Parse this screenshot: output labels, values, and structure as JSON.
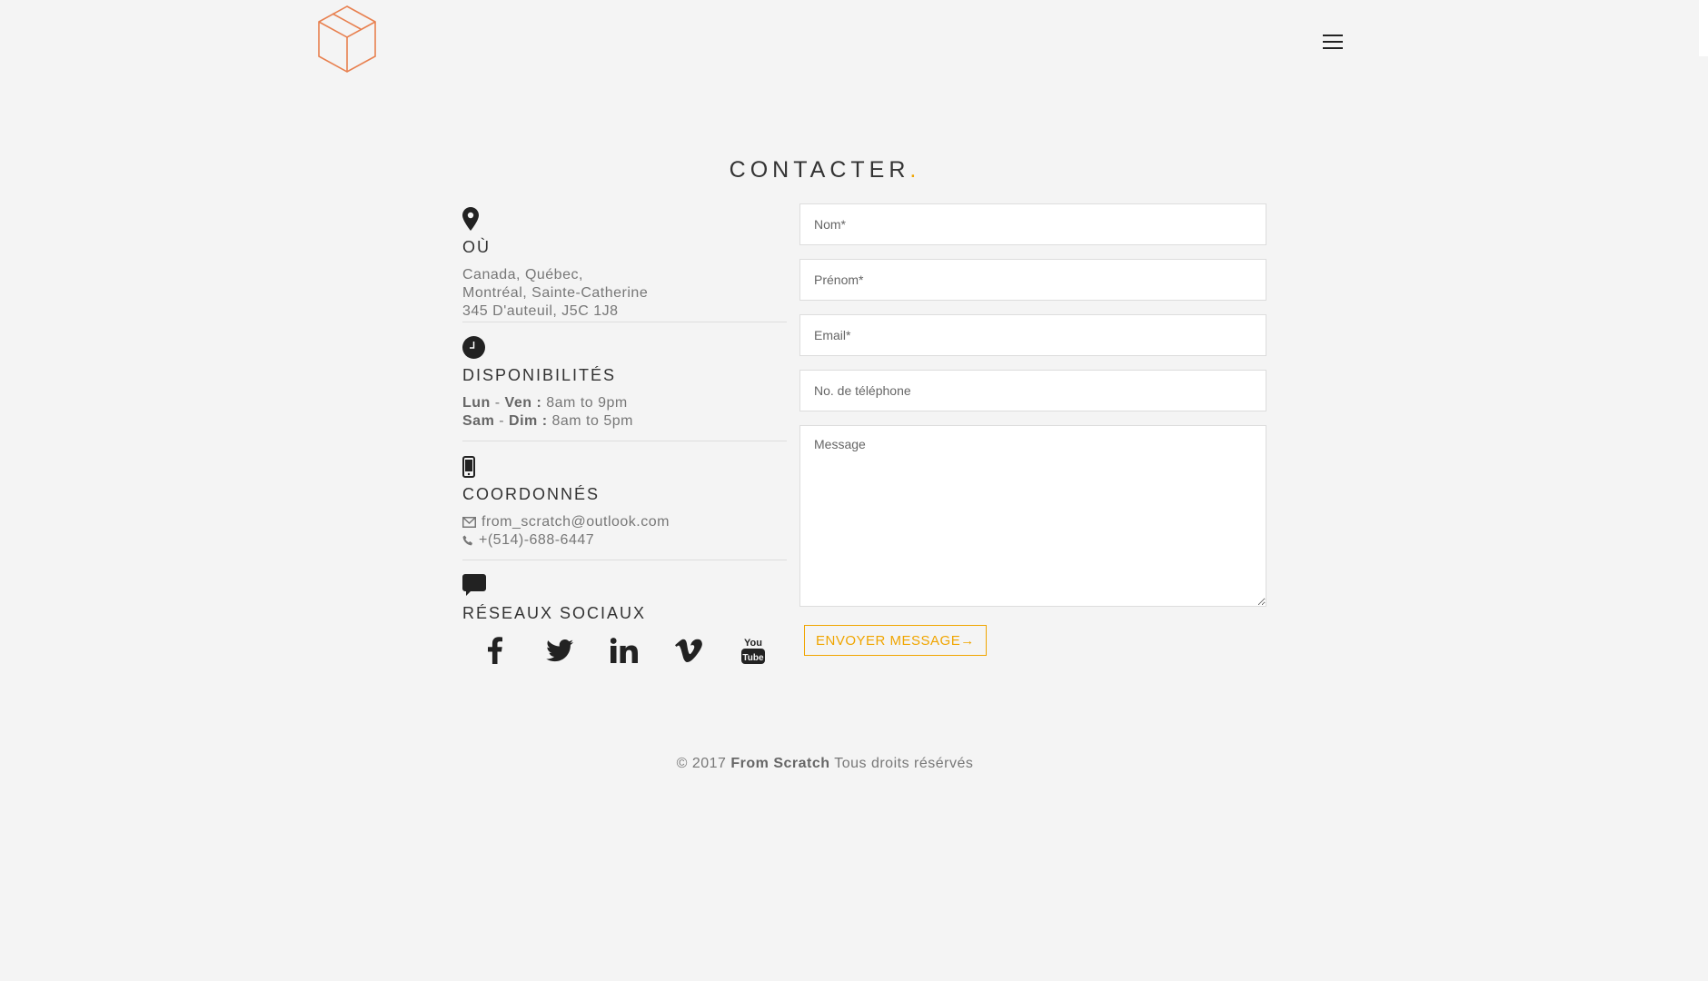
{
  "header": {
    "logo_name": "cube-logo",
    "menu_icon": "hamburger-menu-icon"
  },
  "title": {
    "text": "CONTACTER",
    "dot": "."
  },
  "info": {
    "where": {
      "icon": "map-pin-icon",
      "heading": "OÙ",
      "lines": [
        "Canada, Québec,",
        "Montréal, Sainte-Catherine",
        "345 D'auteuil, J5C 1J8"
      ]
    },
    "availability": {
      "icon": "clock-icon",
      "heading": "DISPONIBILITÉS",
      "rows": [
        {
          "day_start": "Lun",
          "sep": " - ",
          "day_end": "Ven",
          "colon": " :",
          "hours": " 8am to 9pm"
        },
        {
          "day_start": "Sam",
          "sep": " - ",
          "day_end": "Dim",
          "colon": " :",
          "hours": " 8am to 5pm"
        }
      ]
    },
    "contact": {
      "icon": "mobile-phone-icon",
      "heading": "COORDONNÉS",
      "email": "from_scratch@outlook.com",
      "phone": "+(514)-688-6447"
    },
    "social": {
      "icon": "chat-bubble-icon",
      "heading": "RÉSEAUX SOCIAUX",
      "networks": [
        "facebook",
        "twitter",
        "linkedin",
        "vimeo",
        "youtube"
      ]
    }
  },
  "form": {
    "name_placeholder": "Nom*",
    "firstname_placeholder": "Prénom*",
    "email_placeholder": "Email*",
    "phone_placeholder": "No. de téléphone",
    "message_placeholder": "Message",
    "send_label": "ENVOYER MESSAGE",
    "send_arrow": "→"
  },
  "footer": {
    "copyright": "© 2017",
    "brand": "From Scratch",
    "rights": "Tous droits résérvés"
  },
  "colors": {
    "background": "#f4f4f4",
    "accent": "#f0a500",
    "logo": "#e8804f"
  }
}
